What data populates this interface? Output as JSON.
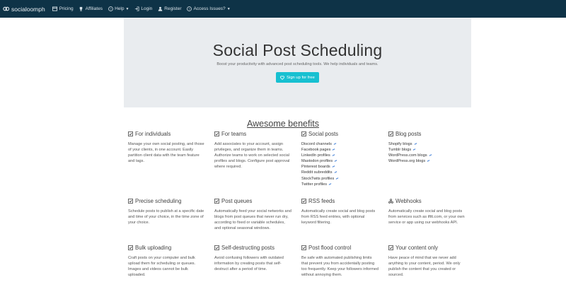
{
  "navbar": {
    "brand": "socialoomph",
    "items": [
      {
        "label": "Pricing",
        "icon": "pricing-icon"
      },
      {
        "label": "Affiliates",
        "icon": "trophy-icon"
      },
      {
        "label": "Help",
        "icon": "question-icon",
        "dropdown": true
      },
      {
        "label": "Login",
        "icon": "login-icon"
      },
      {
        "label": "Register",
        "icon": "user-icon"
      },
      {
        "label": "Access Issues?",
        "icon": "question-icon",
        "dropdown": true
      }
    ]
  },
  "hero": {
    "title": "Social Post Scheduling",
    "subtitle": "Boost your productivity with advanced post scheduling tools. We help individuals and teams.",
    "cta": "Sign up for free"
  },
  "benefits": {
    "title": "Awesome benefits",
    "features": [
      {
        "title": "For individuals",
        "icon": "checkbox-icon",
        "body": "Manage your own social posting, and those of your clients, in one account. Easily partition client data with the team feature and tags."
      },
      {
        "title": "For teams",
        "icon": "checkbox-icon",
        "body": "Add associates to your account, assign privileges, and organize them in teams. Authorize teams to work on selected social profiles and blogs. Configure post approval where required."
      },
      {
        "title": "Social posts",
        "icon": "checkbox-icon",
        "links": [
          "Discord channels",
          "Facebook pages",
          "LinkedIn profiles",
          "Mastodon profiles",
          "Pinterest boards",
          "Reddit subreddits",
          "StockTwits profiles",
          "Twitter profiles"
        ]
      },
      {
        "title": "Blog posts",
        "icon": "checkbox-icon",
        "links": [
          "Shopify blogs",
          "Tumblr blogs",
          "WordPress.com blogs",
          "WordPress.org blogs"
        ]
      },
      {
        "title": "Precise scheduling",
        "icon": "checkbox-icon",
        "body": "Schedule posts to publish at a specific date and time of your choice, in the time zone of your choice."
      },
      {
        "title": "Post queues",
        "icon": "checkbox-icon",
        "body": "Automatically feed your social networks and blogs from post queues that never run dry, according to fixed or variable schedules, and optional seasonal windows."
      },
      {
        "title": "RSS feeds",
        "icon": "checkbox-icon",
        "body": "Automatically create social and blog posts from RSS feed entries, with optional keyword filtering."
      },
      {
        "title": "Webhooks",
        "icon": "webhook-icon",
        "body": "Automatically create social and blog posts from services such as ifttt.com, or your own service or app using our webhooks API."
      },
      {
        "title": "Bulk uploading",
        "icon": "checkbox-icon",
        "body": "Craft posts on your computer and bulk upload them for scheduling or queues. Images and videos cannot be bulk uploaded."
      },
      {
        "title": "Self-destructing posts",
        "icon": "checkbox-icon",
        "body": "Avoid confusing followers with outdated information by creating posts that self-destruct after a period of time."
      },
      {
        "title": "Post flood control",
        "icon": "checkbox-icon",
        "body": "Be safe with automated publishing limits that prevent you from accidentally posting too frequently. Keep your followers informed without annoying them."
      },
      {
        "title": "Your content only",
        "icon": "checkbox-icon",
        "body": "Have peace of mind that we never add anything to your content, period. We only publish the content that you created or sourced."
      }
    ]
  }
}
